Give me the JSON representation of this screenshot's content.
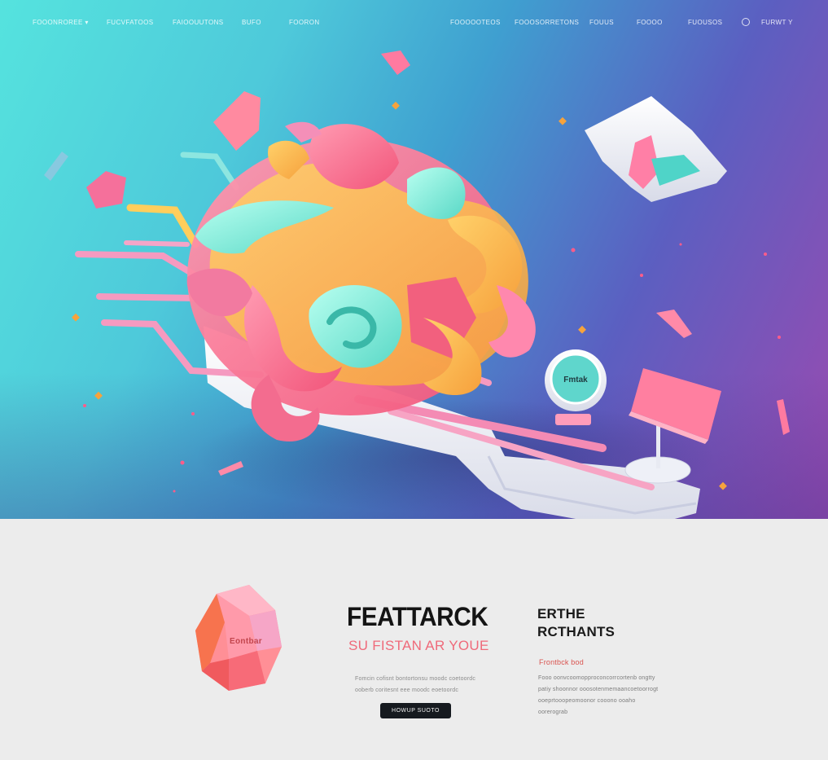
{
  "nav": {
    "left_items": [
      "FOOONROREE",
      "FUCVFATOOS",
      "FAIOOUUTONS",
      "BUFO",
      "FOORON"
    ],
    "left_dropdown_caret": "▾",
    "right_items": [
      "FOOOOOTEOS",
      "FOOOSORRETONS",
      "FOUUS",
      "FOOOO",
      "FUOUSOS"
    ],
    "language": "FURWT Y"
  },
  "hero": {
    "badge_label": "Fmtak"
  },
  "gem": {
    "label": "Eontbar"
  },
  "feature": {
    "title": "FEATTARCK",
    "subtitle": "SU FISTAN AR YOUE",
    "body": "Fomcin cofisnt bontortonsu moodc coetoordc ooberb coritesnt eee moodc eoetoordc",
    "cta_label": "HOWUP SUOTO"
  },
  "side": {
    "title_line1": "ERTHE",
    "title_line2": "RCTHANTS",
    "tag": "Frontbck bod",
    "body": "Fooo oonvcoomopproconcorrcortenb ongtty patiy shoonnor ooosotenmemaancoetoorrogt ooeprtooopeomoonor cooono ooaho oorerograb"
  },
  "colors": {
    "hero_gradient_start": "#55e3de",
    "hero_gradient_end": "#9b4ab0",
    "accent_pink": "#ef6a7a",
    "cta_bg": "#161a1f",
    "page_bg": "#ececec"
  }
}
